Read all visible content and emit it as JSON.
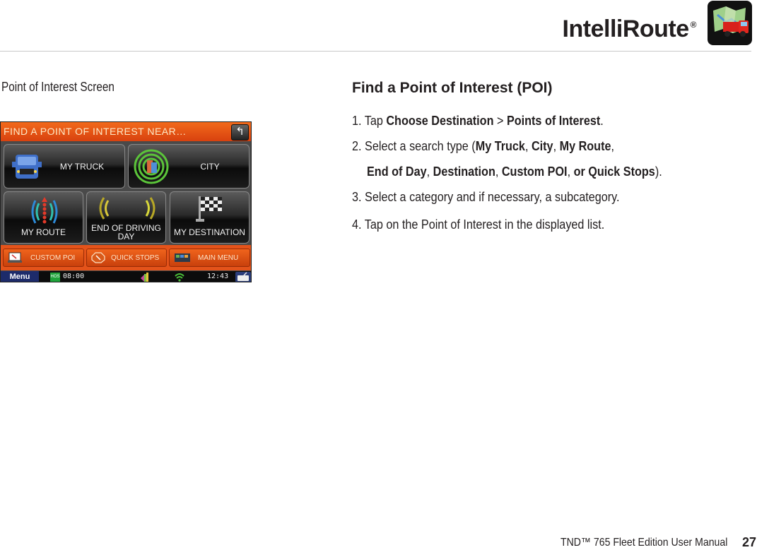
{
  "header": {
    "title": "IntelliRoute",
    "registered_mark": "®",
    "icon": "intelliroute-truck-map-icon"
  },
  "figure": {
    "caption": "Point of Interest Screen",
    "screen": {
      "title": "FIND A POINT OF INTEREST NEAR…",
      "back_icon": "back-arrow-icon",
      "tiles": [
        {
          "label": "MY TRUCK",
          "icon": "truck-icon"
        },
        {
          "label": "CITY",
          "icon": "city-building-icon"
        },
        {
          "label": "MY ROUTE",
          "icon": "route-icon"
        },
        {
          "label_line1": "END OF DRIVING",
          "label_line2": "DAY",
          "icon": "end-of-day-icon"
        },
        {
          "label": "MY DESTINATION",
          "icon": "checkered-flag-icon"
        }
      ],
      "bottom_buttons": [
        {
          "label": "CUSTOM POI",
          "icon": "custom-poi-icon"
        },
        {
          "label": "QUICK STOPS",
          "icon": "quick-stops-icon"
        },
        {
          "label": "MAIN MENU",
          "icon": "main-menu-icon"
        }
      ],
      "status_bar": {
        "menu_label": "Menu",
        "hos_badge": "HOS",
        "hos_time": "08:00",
        "clock": "12:43",
        "icons": [
          "volume-icon",
          "wifi-signal-icon",
          "keyboard-icon"
        ]
      }
    }
  },
  "section": {
    "heading": "Find a Point of Interest (POI)",
    "steps": [
      {
        "num": "1.",
        "pre": "Tap ",
        "b1": "Choose Destination",
        "mid": " > ",
        "b2": "Points of Interest",
        "post": "."
      },
      {
        "num": "2.",
        "pre": "Select a search type (",
        "b1": "My Truck",
        "s1": ", ",
        "b2": "City",
        "s2": ", ",
        "b3": "My Route",
        "s3": ","
      },
      {
        "cont": true,
        "b1": "End of Day",
        "s1": ", ",
        "b2": "Destination",
        "s2": ", ",
        "b3": "Custom POI",
        "s3": ", ",
        "b4": "or Quick Stops",
        "post": ")."
      },
      {
        "num": "3.",
        "text": "Select a category and if necessary, a subcategory."
      },
      {
        "num": "4.",
        "text": "Tap on the Point of Interest in the displayed list."
      }
    ]
  },
  "footer": {
    "manual": "TND™ 765 Fleet Edition User Manual",
    "page": "27"
  }
}
